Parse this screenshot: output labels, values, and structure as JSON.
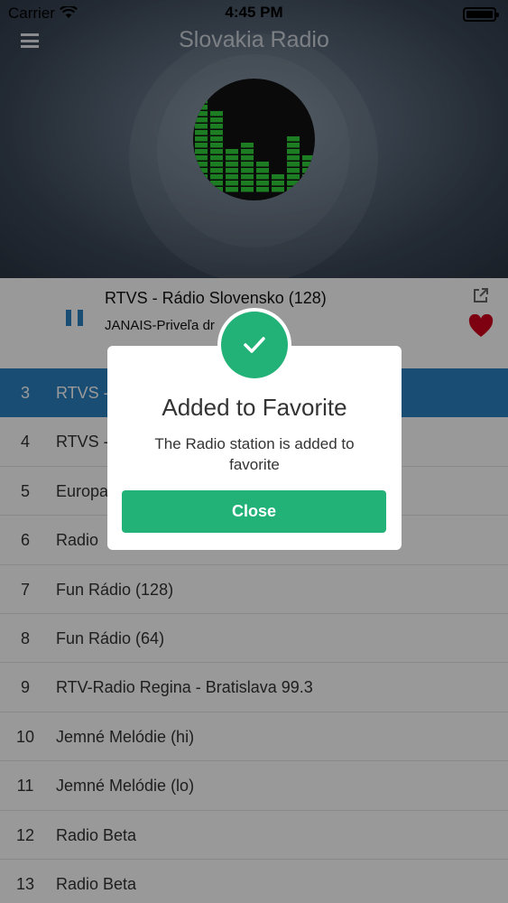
{
  "status_bar": {
    "carrier": "Carrier",
    "time": "4:45 PM"
  },
  "header": {
    "app_title": "Slovakia Radio"
  },
  "now_playing": {
    "title": "RTVS - Rádio Slovensko (128)",
    "subtitle": "JANAIS-Priveľa dr"
  },
  "stations": [
    {
      "num": "3",
      "name": "RTVS -"
    },
    {
      "num": "4",
      "name": "RTVS -"
    },
    {
      "num": "5",
      "name": "Europa"
    },
    {
      "num": "6",
      "name": "Radio"
    },
    {
      "num": "7",
      "name": "Fun Rádio (128)"
    },
    {
      "num": "8",
      "name": "Fun Rádio (64)"
    },
    {
      "num": "9",
      "name": "RTV-Radio Regina - Bratislava 99.3"
    },
    {
      "num": "10",
      "name": "Jemné Melódie (hi)"
    },
    {
      "num": "11",
      "name": "Jemné Melódie (lo)"
    },
    {
      "num": "12",
      "name": "Radio Beta"
    },
    {
      "num": "13",
      "name": "Radio Beta"
    }
  ],
  "modal": {
    "title": "Added to Favorite",
    "message": "The Radio station is added to favorite",
    "close_label": "Close"
  },
  "icons": {
    "menu": "menu-icon",
    "pause": "pause-icon",
    "share": "share-icon",
    "heart": "heart-icon",
    "check": "check-icon",
    "wifi": "wifi-icon",
    "battery": "battery-icon"
  },
  "colors": {
    "accent": "#2a80c0",
    "success": "#22b277",
    "heart": "#d0021b",
    "eq": "#2fd03a"
  }
}
